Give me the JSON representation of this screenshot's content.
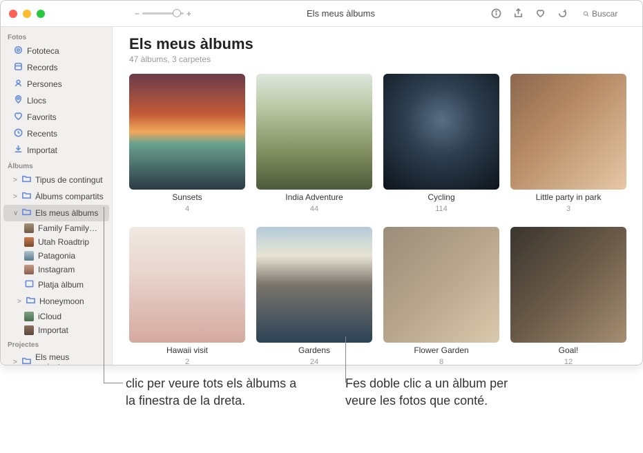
{
  "window_title": "Els meus àlbums",
  "search": {
    "placeholder": "Buscar"
  },
  "zoom": {
    "minus": "−",
    "plus": "+"
  },
  "sidebar": {
    "sections": [
      {
        "header": "Fotos",
        "items": [
          {
            "label": "Fototeca",
            "icon": "photos"
          },
          {
            "label": "Records",
            "icon": "memories"
          },
          {
            "label": "Persones",
            "icon": "people"
          },
          {
            "label": "Llocs",
            "icon": "places"
          },
          {
            "label": "Favorits",
            "icon": "heart"
          },
          {
            "label": "Recents",
            "icon": "clock"
          },
          {
            "label": "Importat",
            "icon": "import"
          }
        ]
      },
      {
        "header": "Àlbums",
        "items": [
          {
            "label": "Tipus de contingut",
            "icon": "folder",
            "disclosure": ">"
          },
          {
            "label": "Àlbums compartits",
            "icon": "folder",
            "disclosure": ">"
          },
          {
            "label": "Els meus àlbums",
            "icon": "folder",
            "disclosure": "∨",
            "selected": true
          },
          {
            "label": "Family Family…",
            "icon": "thumb",
            "sub": true
          },
          {
            "label": "Utah Roadtrip",
            "icon": "thumb",
            "sub": true
          },
          {
            "label": "Patagonia",
            "icon": "thumb",
            "sub": true
          },
          {
            "label": "Instagram",
            "icon": "thumb",
            "sub": true
          },
          {
            "label": "Platja àlbum",
            "icon": "album",
            "sub": true
          },
          {
            "label": "Honeymoon",
            "icon": "folder",
            "sub": true,
            "disclosure": ">"
          },
          {
            "label": "iCloud",
            "icon": "thumb",
            "sub": true
          },
          {
            "label": "Importat",
            "icon": "thumb",
            "sub": true
          }
        ]
      },
      {
        "header": "Projectes",
        "items": [
          {
            "label": "Els meus projectes",
            "icon": "folder",
            "disclosure": ">"
          }
        ]
      }
    ]
  },
  "main": {
    "title": "Els meus àlbums",
    "subtitle": "47 àlbums, 3 carpetes",
    "albums": [
      {
        "name": "Sunsets",
        "count": "4"
      },
      {
        "name": "India Adventure",
        "count": "44"
      },
      {
        "name": "Cycling",
        "count": "114"
      },
      {
        "name": "Little party in park",
        "count": "3"
      },
      {
        "name": "Hawaii visit",
        "count": "2"
      },
      {
        "name": "Gardens",
        "count": "24"
      },
      {
        "name": "Flower Garden",
        "count": "8"
      },
      {
        "name": "Goal!",
        "count": "12"
      }
    ]
  },
  "callouts": {
    "left": "clic per veure tots els àlbums a la finestra de la dreta.",
    "right": "Fes doble clic a un àlbum per veure les fotos que conté."
  }
}
